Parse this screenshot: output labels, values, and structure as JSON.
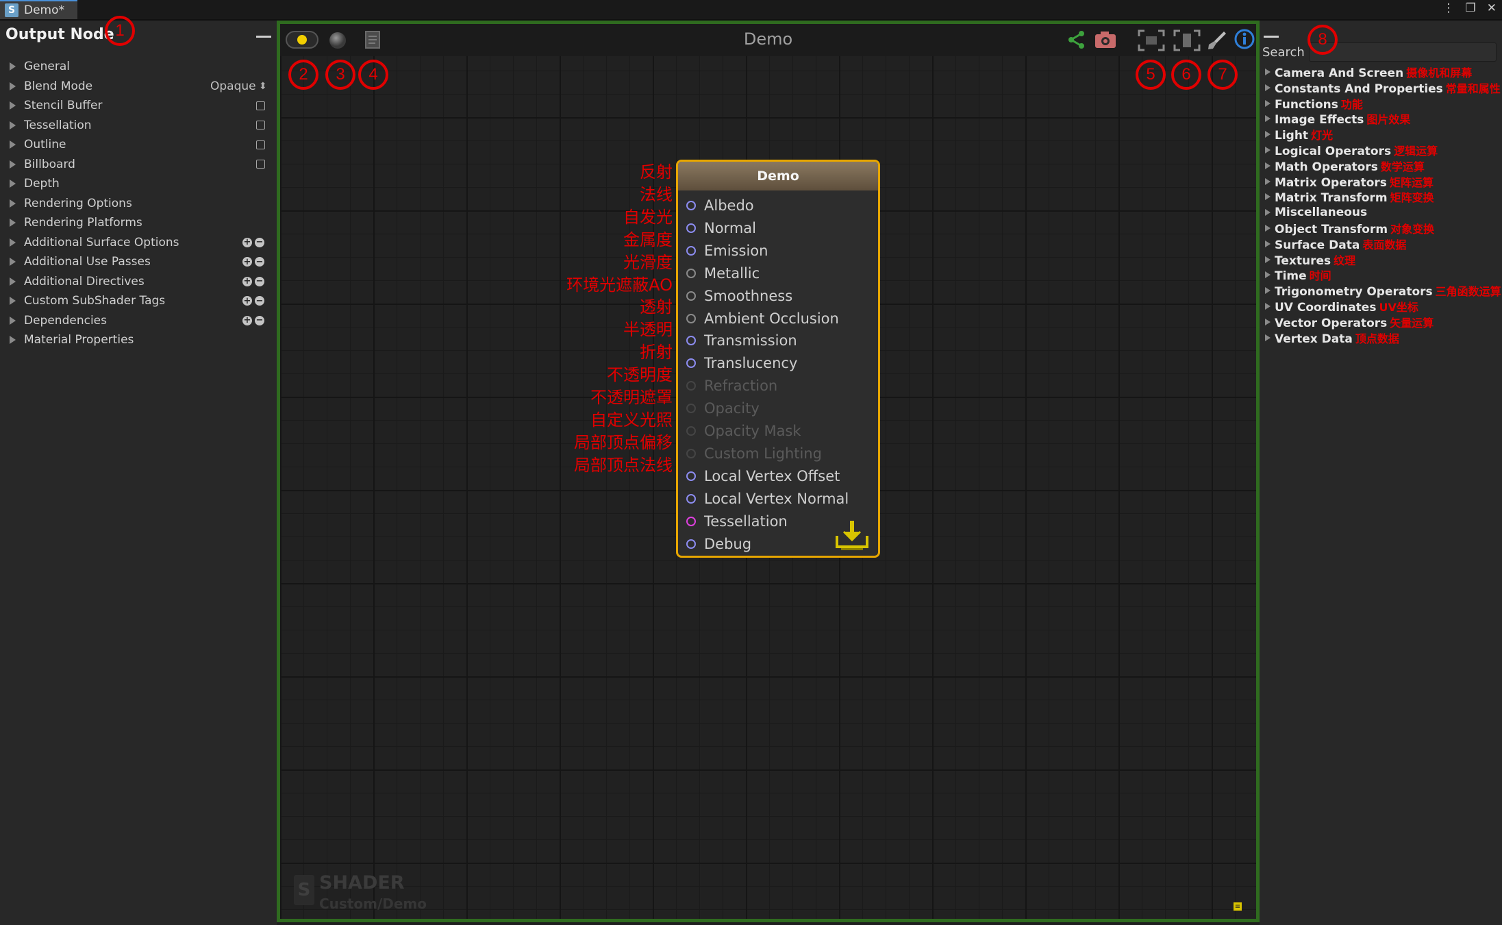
{
  "window": {
    "tab_title": "Demo*",
    "tab_logo": "S"
  },
  "left_panel": {
    "title": "Output Node",
    "rows": [
      {
        "label": "General"
      },
      {
        "label": "Blend Mode",
        "value": "Opaque"
      },
      {
        "label": "Stencil Buffer",
        "checkbox": true
      },
      {
        "label": "Tessellation",
        "checkbox": true
      },
      {
        "label": "Outline",
        "checkbox": true
      },
      {
        "label": "Billboard",
        "checkbox": true
      },
      {
        "label": "Depth"
      },
      {
        "label": "Rendering Options"
      },
      {
        "label": "Rendering Platforms"
      },
      {
        "label": "Additional Surface Options",
        "plusminus": true
      },
      {
        "label": "Additional Use Passes",
        "plusminus": true
      },
      {
        "label": "Additional Directives",
        "plusminus": true
      },
      {
        "label": "Custom SubShader Tags",
        "plusminus": true
      },
      {
        "label": "Dependencies",
        "plusminus": true
      },
      {
        "label": "Material Properties"
      }
    ]
  },
  "canvas": {
    "title": "Demo",
    "watermark_title": "SHADER",
    "watermark_sub": "Custom/Demo",
    "watermark_logo": "S"
  },
  "node": {
    "title": "Demo",
    "ports": [
      {
        "label": "Albedo",
        "state": "active"
      },
      {
        "label": "Normal",
        "state": "active"
      },
      {
        "label": "Emission",
        "state": "active"
      },
      {
        "label": "Metallic",
        "state": "gray"
      },
      {
        "label": "Smoothness",
        "state": "gray"
      },
      {
        "label": "Ambient Occlusion",
        "state": "gray"
      },
      {
        "label": "Transmission",
        "state": "active"
      },
      {
        "label": "Translucency",
        "state": "active"
      },
      {
        "label": "Refraction",
        "state": "dim"
      },
      {
        "label": "Opacity",
        "state": "dim"
      },
      {
        "label": "Opacity Mask",
        "state": "dim"
      },
      {
        "label": "Custom Lighting",
        "state": "dim"
      },
      {
        "label": "Local Vertex Offset",
        "state": "active"
      },
      {
        "label": "Local Vertex Normal",
        "state": "active"
      },
      {
        "label": "Tessellation",
        "state": "magenta"
      },
      {
        "label": "Debug",
        "state": "active"
      }
    ]
  },
  "annotations": {
    "port_notes": [
      "反射",
      "法线",
      "自发光",
      "金属度",
      "光滑度",
      "环境光遮蔽AO",
      "透射",
      "半透明",
      "折射",
      "不透明度",
      "不透明遮罩",
      "自定义光照",
      "局部顶点偏移",
      "局部顶点法线"
    ],
    "circle_numbers": [
      "1",
      "2",
      "3",
      "4",
      "5",
      "6",
      "7",
      "8"
    ],
    "color": "#e00000"
  },
  "right_panel": {
    "search_label": "Search",
    "search_value": "",
    "categories": [
      {
        "en": "Camera And Screen",
        "zh": "摄像机和屏幕"
      },
      {
        "en": "Constants And Properties",
        "zh": "常量和属性"
      },
      {
        "en": "Functions",
        "zh": "功能"
      },
      {
        "en": "Image Effects",
        "zh": "图片效果"
      },
      {
        "en": "Light",
        "zh": "灯光"
      },
      {
        "en": "Logical Operators",
        "zh": "逻辑运算"
      },
      {
        "en": "Math Operators",
        "zh": "数学运算"
      },
      {
        "en": "Matrix Operators",
        "zh": "矩阵运算"
      },
      {
        "en": "Matrix Transform",
        "zh": "矩阵变换"
      },
      {
        "en": "Miscellaneous",
        "zh": ""
      },
      {
        "en": "Object Transform",
        "zh": "对象变换"
      },
      {
        "en": "Surface Data",
        "zh": "表面数据"
      },
      {
        "en": "Textures",
        "zh": "纹理"
      },
      {
        "en": "Time",
        "zh": "时间"
      },
      {
        "en": "Trigonometry Operators",
        "zh": "三角函数运算"
      },
      {
        "en": "UV Coordinates",
        "zh": "UV坐标"
      },
      {
        "en": "Vector Operators",
        "zh": "矢量运算"
      },
      {
        "en": "Vertex Data",
        "zh": "顶点数据"
      }
    ]
  },
  "colors": {
    "canvas_border": "#2f6b1f",
    "node_border": "#e7a600",
    "port_active": "#8c8cf0",
    "port_magenta": "#e040e0"
  },
  "icons": [
    "live-preview-icon",
    "preview-sphere-icon",
    "shader-file-icon",
    "share-icon",
    "camera-icon",
    "focus-selected-icon",
    "focus-all-icon",
    "cleanup-brush-icon",
    "info-icon",
    "save-icon",
    "window-menu-icon",
    "maximize-icon",
    "close-icon"
  ]
}
